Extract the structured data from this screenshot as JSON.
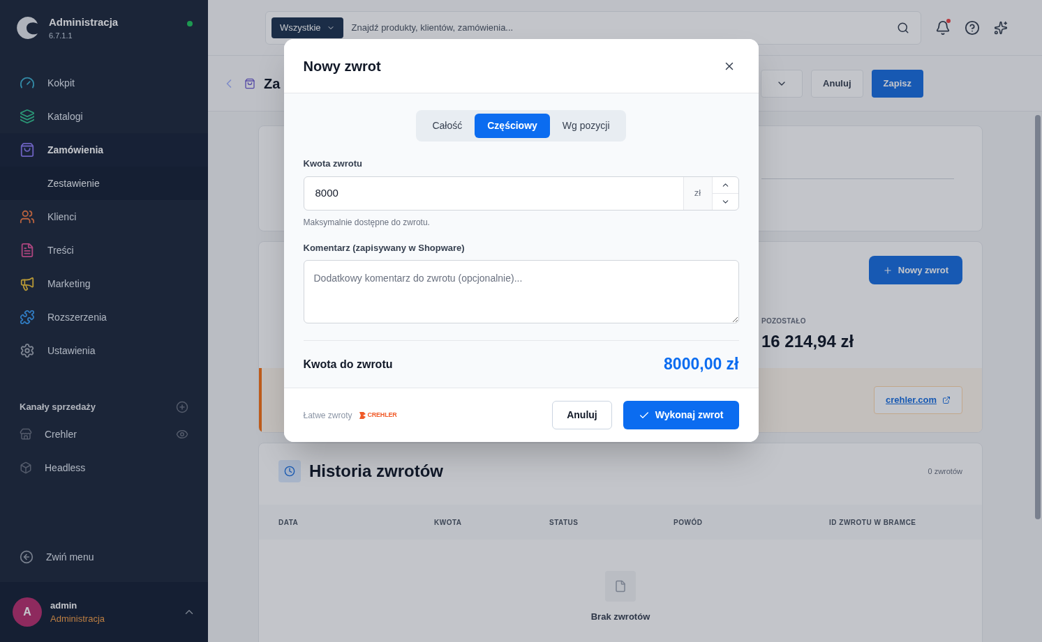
{
  "sidebar": {
    "title": "Administracja",
    "version": "6.7.1.1",
    "items": [
      {
        "label": "Kokpit",
        "selected": false
      },
      {
        "label": "Katalogi",
        "selected": false
      },
      {
        "label": "Zamówienia",
        "selected": true
      },
      {
        "label": "Zestawienie",
        "selected": true,
        "kind": "sub"
      },
      {
        "label": "Klienci",
        "selected": false
      },
      {
        "label": "Treści",
        "selected": false
      },
      {
        "label": "Marketing",
        "selected": false
      },
      {
        "label": "Rozszerzenia",
        "selected": false
      },
      {
        "label": "Ustawienia",
        "selected": false
      }
    ],
    "channels_title": "Kanały sprzedaży",
    "channels": [
      {
        "label": "Crehler"
      },
      {
        "label": "Headless"
      }
    ],
    "collapse": "Zwiń menu",
    "user": {
      "initial": "A",
      "name": "admin",
      "role": "Administracja"
    }
  },
  "topbar": {
    "scope": "Wszystkie",
    "search_placeholder": "Znajdź produkty, klientów, zamówienia..."
  },
  "header": {
    "title": "Za",
    "buttons": [
      "Anuluj",
      "Zapisz"
    ]
  },
  "refund_card": {
    "new_button": "Nowy zwrot",
    "remaining_label": "POZOSTAŁO",
    "remaining_value": "16 214,94 zł",
    "link": "crehler.com"
  },
  "history": {
    "title": "Historia zwrotów",
    "count": "0 zwrotów",
    "columns": [
      "DATA",
      "KWOTA",
      "STATUS",
      "POWÓD",
      "ID ZWROTU W BRAMCE"
    ],
    "empty": "Brak zwrotów"
  },
  "modal": {
    "title": "Nowy zwrot",
    "tabs": [
      {
        "label": "Całość",
        "selected": false
      },
      {
        "label": "Częściowy",
        "selected": true
      },
      {
        "label": "Wg pozycji",
        "selected": false
      }
    ],
    "amount": {
      "label": "Kwota zwrotu",
      "value": "8000",
      "unit": "zł",
      "hint": "Maksymalnie dostępne do zwrotu."
    },
    "comment": {
      "label": "Komentarz (zapisywany w Shopware)",
      "placeholder": "Dodatkowy komentarz do zwrotu (opcjonalnie)..."
    },
    "total": {
      "label": "Kwota do zwrotu",
      "value": "8000,00 zł"
    },
    "footer": {
      "note": "Łatwe zwroty",
      "logo": "CREHLER"
    },
    "cancel": "Anuluj",
    "submit": "Wykonaj zwrot"
  }
}
